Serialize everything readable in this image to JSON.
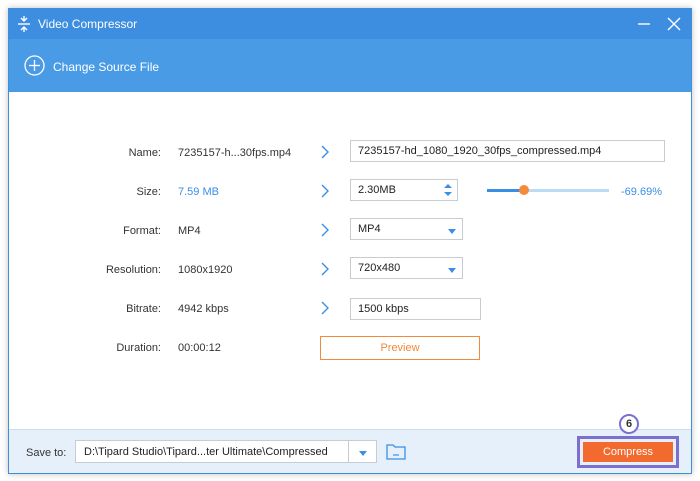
{
  "window": {
    "title": "Video Compressor",
    "change_source_label": "Change Source File"
  },
  "form": {
    "name": {
      "label": "Name:",
      "source": "7235157-h...30fps.mp4",
      "output": "7235157-hd_1080_1920_30fps_compressed.mp4"
    },
    "size": {
      "label": "Size:",
      "source": "7.59 MB",
      "output": "2.30MB",
      "percent": "-69.69%",
      "slider_fraction": 0.3031
    },
    "format": {
      "label": "Format:",
      "source": "MP4",
      "output": "MP4"
    },
    "resolution": {
      "label": "Resolution:",
      "source": "1080x1920",
      "output": "720x480"
    },
    "bitrate": {
      "label": "Bitrate:",
      "source": "4942 kbps",
      "output": "1500 kbps"
    },
    "duration": {
      "label": "Duration:",
      "source": "00:00:12"
    },
    "preview_label": "Preview"
  },
  "bottom": {
    "save_to_label": "Save to:",
    "save_path": "D:\\Tipard Studio\\Tipard...ter Ultimate\\Compressed",
    "compress_label": "Compress",
    "step_badge": "6"
  },
  "colors": {
    "titlebar": "#3d8ee0",
    "source_bar": "#4a9be6",
    "accent_blue": "#3a8ee6",
    "accent_orange": "#f26a2e",
    "highlight_purple": "#7c6fcf"
  }
}
